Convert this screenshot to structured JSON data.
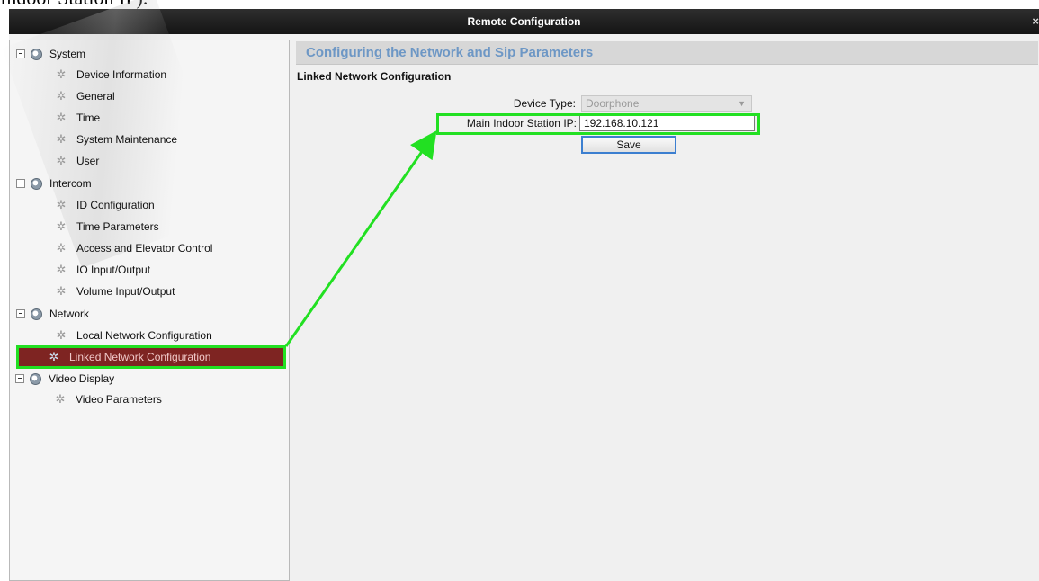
{
  "document": {
    "caption": "Indoor Station IP)."
  },
  "window": {
    "title": "Remote Configuration",
    "close_glyph": "×"
  },
  "sidebar": {
    "groups": [
      {
        "label": "System",
        "items": [
          {
            "label": "Device Information"
          },
          {
            "label": "General"
          },
          {
            "label": "Time"
          },
          {
            "label": "System Maintenance"
          },
          {
            "label": "User"
          }
        ]
      },
      {
        "label": "Intercom",
        "items": [
          {
            "label": "ID Configuration"
          },
          {
            "label": "Time Parameters"
          },
          {
            "label": "Access and Elevator Control"
          },
          {
            "label": "IO Input/Output"
          },
          {
            "label": "Volume Input/Output"
          }
        ]
      },
      {
        "label": "Network",
        "items": [
          {
            "label": "Local Network Configuration"
          },
          {
            "label": "Linked Network Configuration",
            "selected": true
          }
        ]
      },
      {
        "label": "Video Display",
        "items": [
          {
            "label": "Video Parameters"
          }
        ]
      }
    ]
  },
  "main": {
    "header": "Configuring the Network and Sip Parameters",
    "section_title": "Linked Network Configuration",
    "device_type": {
      "label": "Device Type:",
      "value": "Doorphone"
    },
    "main_indoor_ip": {
      "label": "Main Indoor Station IP:",
      "value": "192.168.10.121"
    },
    "save_label": "Save"
  },
  "annotation": {
    "color": "#22e022"
  },
  "colors": {
    "selected_bg": "#7e2422",
    "header_text": "#6d97c5",
    "titlebar": "#1f1f1f"
  },
  "icons": {
    "group": "device-group-icon",
    "item": "gear-icon",
    "dropdown": "chevron-down-icon"
  }
}
